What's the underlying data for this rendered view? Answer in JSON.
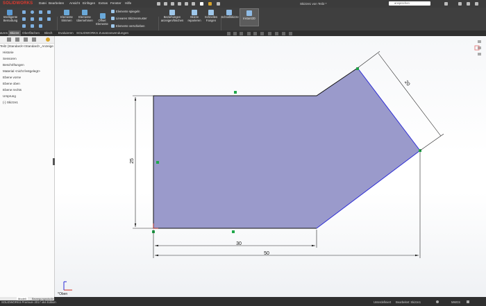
{
  "app": {
    "logo": "SOLIDWORKS",
    "document_title": "Skizze1 von Teil2 *",
    "search_placeholder": "ansprechen"
  },
  "menu": [
    "Datei",
    "Bearbeiten",
    "Ansicht",
    "Einfügen",
    "Extras",
    "Fenster",
    "Hilfe"
  ],
  "ribbon": {
    "smart_dimension": "Intelligente Bemaßung",
    "trim": "Elemente trimmen",
    "convert": "Elemente übernehmen",
    "offset": "Offset Elemente",
    "mirror": "Elemente spiegeln",
    "linear_pattern": "Lineares Skizzenmuster",
    "move": "Elemente verschieben",
    "relations": "Beziehungen anzeigen/löschen",
    "repair": "Skizze reparieren",
    "quick_snaps": "Schnelles Fangen",
    "rapid_sketch": "Schnellskizze",
    "instant2d": "Instant2D"
  },
  "command_tabs": [
    "Features",
    "Skizze",
    "Oberflächen",
    "Blech",
    "Evaluieren",
    "SOLIDWORKS Zusatzanwendungen"
  ],
  "feature_tree": {
    "root": "Teil2 (Standard<<Standard>_Anzeigestat",
    "items": [
      "Historie",
      "Sensoren",
      "Beschriftungen",
      "Material <nicht festgelegt>",
      "Ebene vorne",
      "Ebene oben",
      "Ebene rechts",
      "Ursprung",
      "(-) Skizze1"
    ]
  },
  "model_tabs": [
    "Modell",
    "Bewegungsstudie 1"
  ],
  "status": {
    "edition": "SOLIDWORKS Premium 2017 x64 Edition",
    "sketch_state": "Unterdefiniert",
    "editing": "Bearbeitet: Skizze1",
    "units": "MMGS"
  },
  "viewport": {
    "view_label": "*Oben",
    "dimensions": {
      "height": "25",
      "bottom": "30",
      "overall": "50",
      "angled": "20"
    }
  },
  "colors": {
    "sketch_fill": "#9a9acb",
    "sketch_line_blue": "#2b2bd6",
    "sketch_line_black": "#111111",
    "point_green": "#1fa84a",
    "brand_red": "#d52b1e"
  }
}
